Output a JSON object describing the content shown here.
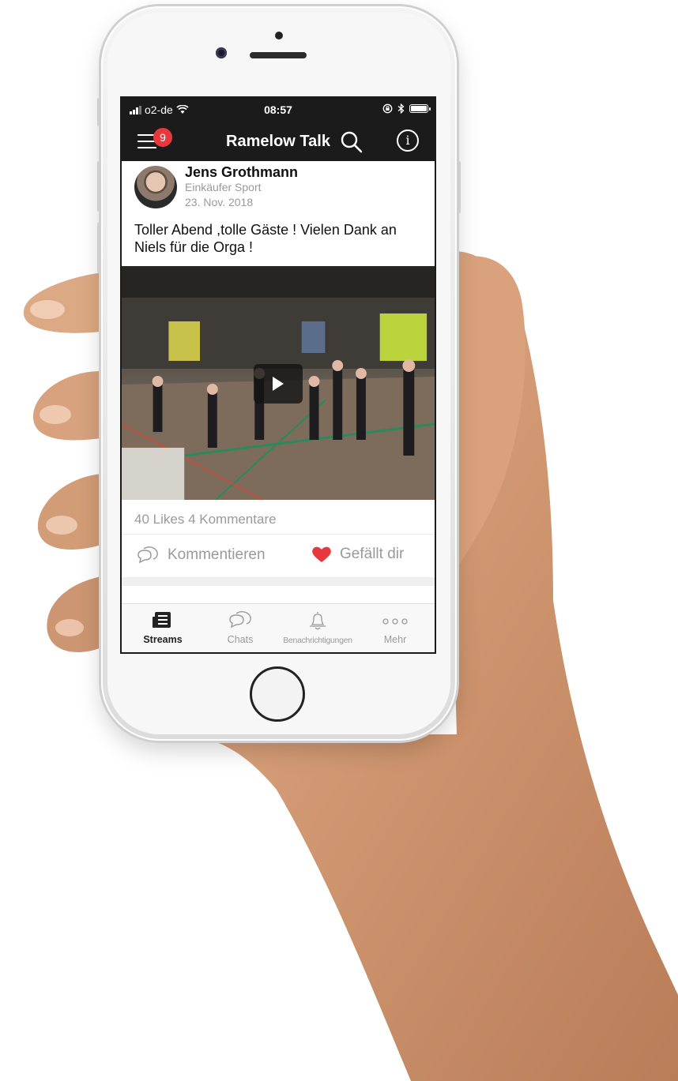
{
  "status_bar": {
    "carrier": "o2-de",
    "time": "08:57"
  },
  "nav": {
    "title": "Ramelow Talk",
    "menu_badge": "9",
    "icons": [
      "menu-icon",
      "search-icon",
      "info-icon"
    ]
  },
  "post": {
    "author_name": "Jens Grothmann",
    "author_role": "Einkäufer Sport",
    "date": "23. Nov. 2018",
    "text": "Toller Abend ,tolle Gäste ! Vielen Dank an Niels für die Orga !",
    "likes": "40 Likes",
    "comments": "4 Kommentare",
    "comment_action": "Kommentieren",
    "like_action": "Gefällt dir",
    "liked": true
  },
  "tabs": [
    {
      "label": "Streams",
      "icon": "newspaper-icon",
      "active": true
    },
    {
      "label": "Chats",
      "icon": "chat-bubbles-icon",
      "active": false
    },
    {
      "label": "Benachrichtigungen",
      "icon": "bell-icon",
      "active": false
    },
    {
      "label": "Mehr",
      "icon": "more-dots-icon",
      "active": false
    }
  ],
  "colors": {
    "bar_background": "#1b1b1b",
    "accent_red": "#e8383d",
    "muted_text": "#9a9a9a"
  }
}
